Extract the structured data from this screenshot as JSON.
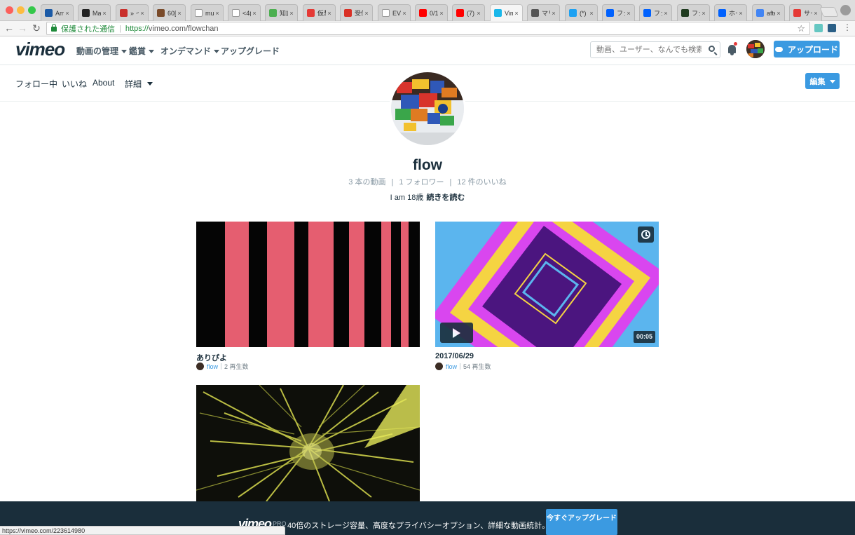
{
  "browser": {
    "tabs": [
      {
        "label": "Am",
        "fav": "#1b5aa6",
        "active": false
      },
      {
        "label": "Ma",
        "fav": "#222222",
        "active": false
      },
      {
        "label": "» イ",
        "fav": "#c9302c",
        "active": false
      },
      {
        "label": "60[",
        "fav": "#7a4b2a",
        "active": false
      },
      {
        "label": "mu",
        "fav": "#ffffff",
        "active": false
      },
      {
        "label": "<4(",
        "fav": "#ffffff",
        "active": false
      },
      {
        "label": "知識",
        "fav": "#4caf50",
        "active": false
      },
      {
        "label": "仮想",
        "fav": "#e53935",
        "active": false
      },
      {
        "label": "受信",
        "fav": "#d93025",
        "active": false
      },
      {
        "label": "EVE",
        "fav": "#ffffff",
        "active": false
      },
      {
        "label": "0/1",
        "fav": "#ff0000",
        "active": false
      },
      {
        "label": "(7)",
        "fav": "#ff0000",
        "active": false
      },
      {
        "label": "Vim",
        "fav": "#1ab7ea",
        "active": true
      },
      {
        "label": "マリ",
        "fav": "#555555",
        "active": false
      },
      {
        "label": "(*)",
        "fav": "#1da1f2",
        "active": false
      },
      {
        "label": "ファ",
        "fav": "#0061fe",
        "active": false
      },
      {
        "label": "ファ",
        "fav": "#0061fe",
        "active": false
      },
      {
        "label": "ファ",
        "fav": "#1e3a1e",
        "active": false
      },
      {
        "label": "ホー",
        "fav": "#0061fe",
        "active": false
      },
      {
        "label": "afte",
        "fav": "#4285f4",
        "active": false
      },
      {
        "label": "サー",
        "fav": "#e53935",
        "active": false
      }
    ],
    "secure_label": "保護された通信",
    "url_scheme": "https://",
    "url_rest": "vimeo.com/flowchan",
    "status_url": "https://vimeo.com/223614980"
  },
  "header": {
    "logo": "vimeo",
    "nav": [
      "動画の管理",
      "鑑賞",
      "オンデマンド",
      "アップグレード"
    ],
    "search_placeholder": "動画、ユーザー、なんでも検索",
    "upload_label": "アップロード"
  },
  "profile_nav": {
    "following": "フォロー中",
    "likes": "いいね",
    "about": "About",
    "more": "詳細",
    "edit": "編集"
  },
  "profile": {
    "name": "flow",
    "videos": "3 本の動画",
    "followers": "1 フォロワー",
    "likes": "12 件のいいね",
    "stat_sep": "|",
    "bio": "I am 18歳",
    "read_more": "続きを読む"
  },
  "videos": [
    {
      "title": "ありぴよ",
      "user": "flow",
      "plays": "2 再生数"
    },
    {
      "title": "2017/06/29",
      "user": "flow",
      "plays": "54 再生数",
      "duration": "00:05"
    },
    {
      "title": "",
      "user": "",
      "plays": ""
    }
  ],
  "banner": {
    "logo": "vimeo",
    "pro": "PRO",
    "text": "40倍のストレージ容量、高度なプライバシーオプション、詳細な動画統計。",
    "button": "今すぐアップグレード"
  },
  "colors": {
    "accent": "#3b9ae1",
    "dark": "#1a2e3b",
    "stripe_pink": "#e55e70",
    "frame_pink": "#d946ef",
    "frame_yellow": "#f5d442",
    "frame_sky": "#5bb5ee"
  }
}
